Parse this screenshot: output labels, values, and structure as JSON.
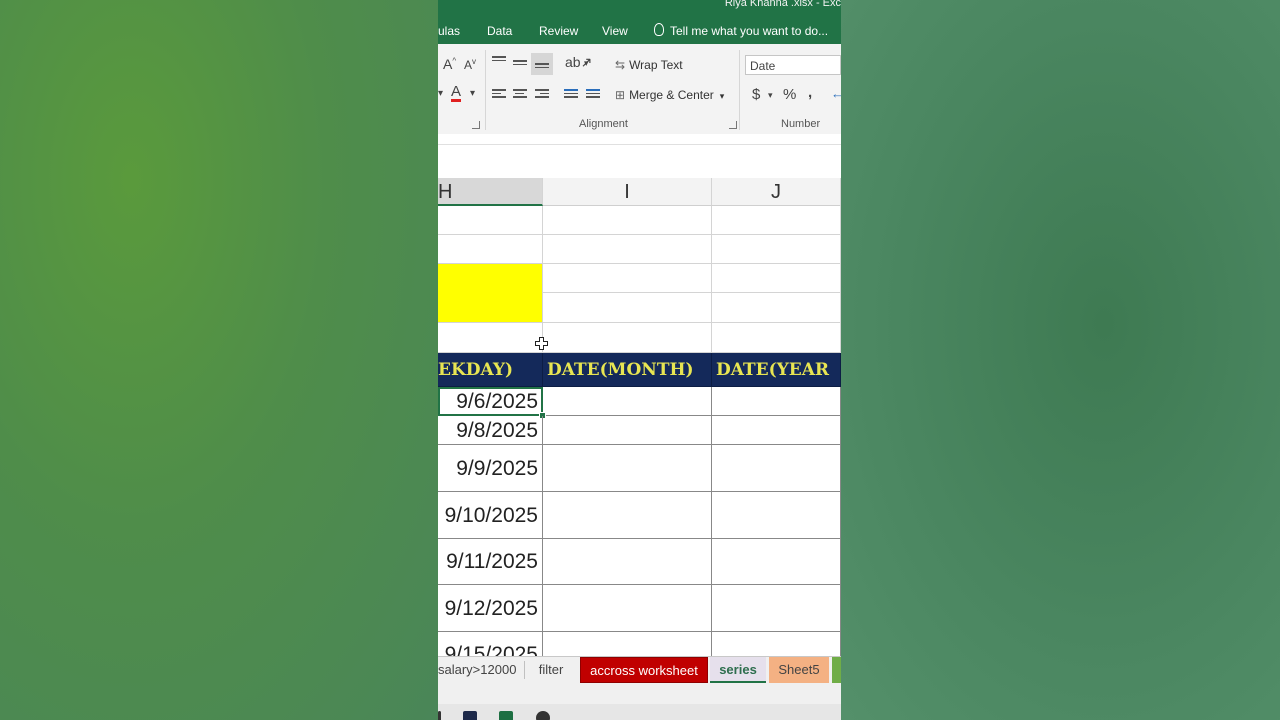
{
  "window": {
    "title": "Riya Khanna .xlsx - Exc"
  },
  "ribbon_tabs": [
    {
      "label": "ulas"
    },
    {
      "label": "Data"
    },
    {
      "label": "Review"
    },
    {
      "label": "View"
    }
  ],
  "tell_me": "Tell me what you want to do...",
  "ribbon": {
    "font_grow": "A",
    "font_shrink": "A",
    "font_color_glyph": "A",
    "wrap_text": "Wrap Text",
    "merge_center": "Merge & Center",
    "number_format": "Date",
    "currency": "$",
    "percent": "%",
    "comma": ",",
    "alignment_label": "Alignment",
    "number_label": "Number"
  },
  "columns": [
    {
      "label": "H",
      "selected": true
    },
    {
      "label": "I",
      "selected": false
    },
    {
      "label": "J",
      "selected": false
    }
  ],
  "header_row": [
    "EKDAY)",
    "DATE(MONTH)",
    "DATE(YEAR"
  ],
  "header_colors": {
    "background": "#14295a",
    "text": "#e8e552"
  },
  "highlight_color": "#ffff00",
  "dates": [
    "9/6/2025",
    "9/8/2025",
    "9/9/2025",
    "9/10/2025",
    "9/11/2025",
    "9/12/2025",
    "9/15/2025"
  ],
  "sheet_tabs": [
    {
      "label": "salary>12000",
      "color": ""
    },
    {
      "label": "filter",
      "color": ""
    },
    {
      "label": "accross worksheet",
      "color": "#c00000"
    },
    {
      "label": "series",
      "color": "#e6e0ec",
      "active": true
    },
    {
      "label": "Sheet5",
      "color": "#f4b183"
    }
  ]
}
